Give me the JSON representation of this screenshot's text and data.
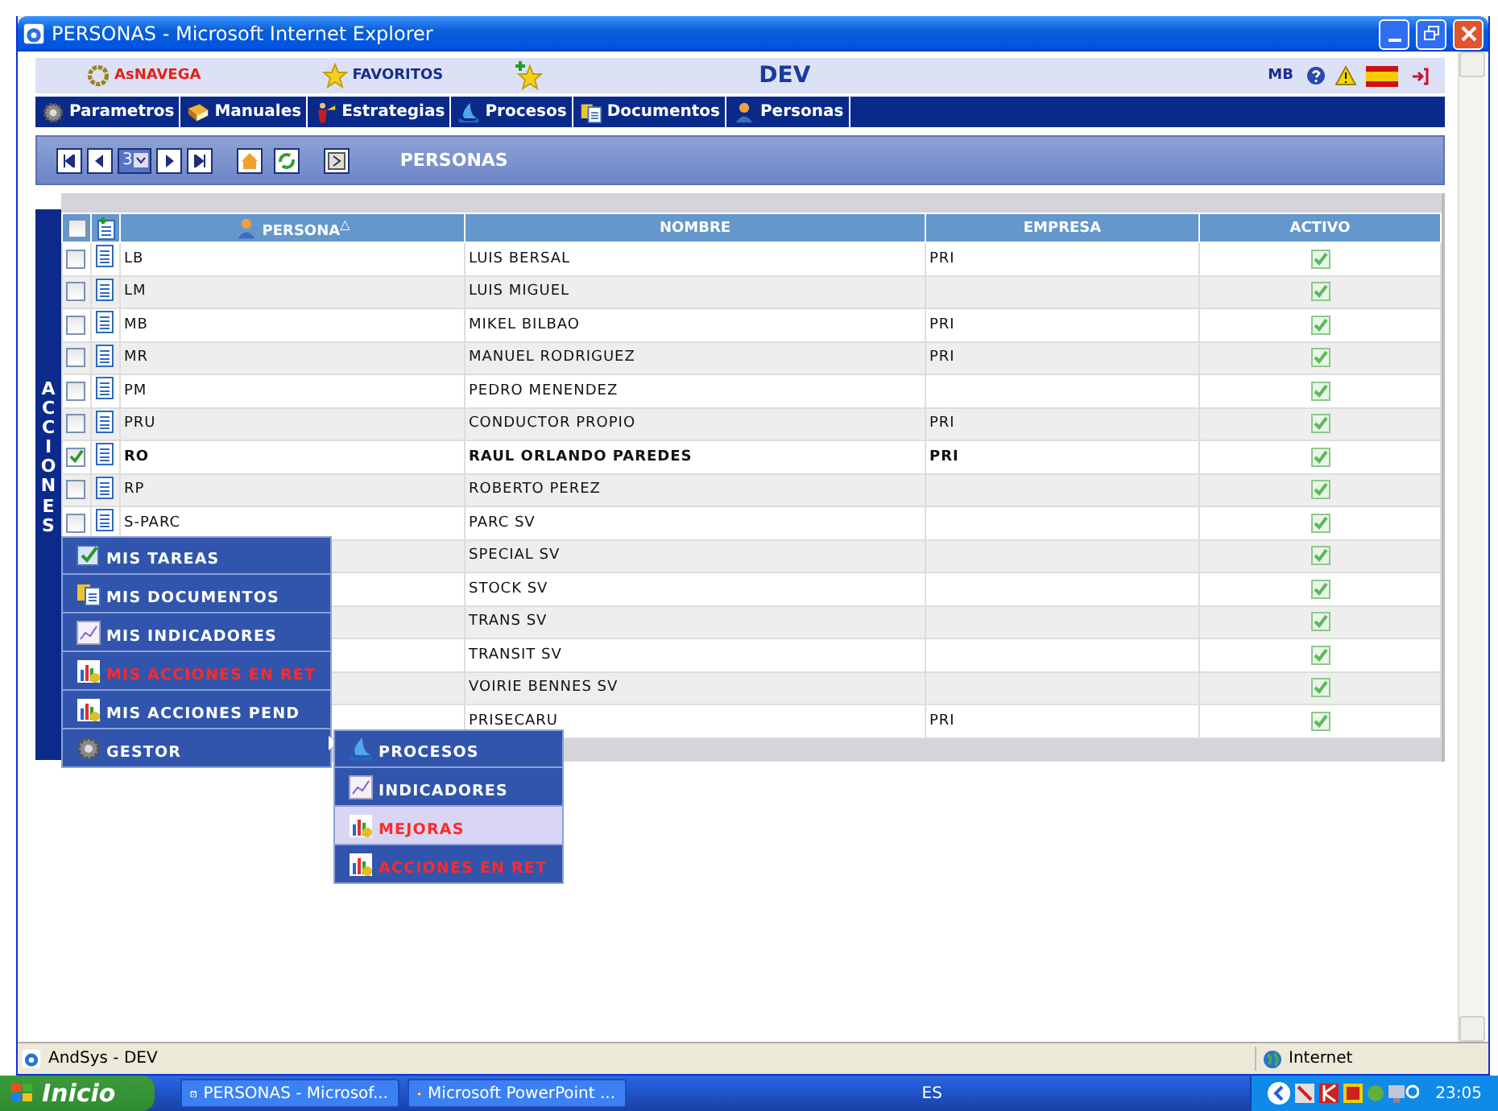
{
  "window": {
    "title": "PERSONAS - Microsoft Internet Explorer"
  },
  "header": {
    "brand": "AsNAVEGA",
    "favorites": "FAVORITOS",
    "environment": "DEV",
    "user": "MB"
  },
  "nav": [
    {
      "label": "Parametros"
    },
    {
      "label": "Manuales"
    },
    {
      "label": "Estrategias"
    },
    {
      "label": "Procesos"
    },
    {
      "label": "Documentos"
    },
    {
      "label": "Personas"
    }
  ],
  "toolbar": {
    "page": "3",
    "title": "PERSONAS"
  },
  "side_tab": {
    "label": "ACCIONES"
  },
  "table": {
    "columns": [
      "PERSONA",
      "NOMBRE",
      "EMPRESA",
      "ACTIVO"
    ],
    "sort_indicator": "△",
    "all_selected": false,
    "rows": [
      {
        "persona": "LB",
        "selected": false,
        "nombre": "LUIS BERSAL",
        "empresa": "PRI",
        "activo": true
      },
      {
        "persona": "LM",
        "selected": false,
        "nombre": "LUIS MIGUEL",
        "activo": true
      },
      {
        "persona": "MB",
        "selected": false,
        "nombre": "MIKEL BILBAO",
        "empresa": "PRI",
        "activo": true
      },
      {
        "persona": "MR",
        "selected": false,
        "nombre": "MANUEL RODRIGUEZ",
        "empresa": "PRI",
        "activo": true
      },
      {
        "persona": "PM",
        "selected": false,
        "nombre": "PEDRO MENENDEZ",
        "activo": true
      },
      {
        "persona": "PRU",
        "selected": false,
        "nombre": "CONDUCTOR PROPIO",
        "empresa": "PRI",
        "activo": true
      },
      {
        "persona": "RO",
        "selected": true,
        "nombre": "RAUL ORLANDO PAREDES",
        "empresa": "PRI",
        "activo": true
      },
      {
        "persona": "RP",
        "selected": false,
        "nombre": "ROBERTO PEREZ",
        "activo": true
      },
      {
        "persona": "S-PARC",
        "selected": false,
        "nombre": "PARC SV",
        "activo": true
      },
      {
        "nombre": "SPECIAL SV",
        "activo": true
      },
      {
        "nombre": "STOCK SV",
        "activo": true
      },
      {
        "nombre": "TRANS SV",
        "activo": true
      },
      {
        "nombre": "TRANSIT SV",
        "activo": true
      },
      {
        "nombre": "VOIRIE BENNES SV",
        "activo": true
      },
      {
        "nombre": "PRISECARU",
        "empresa": "PRI",
        "activo": true
      }
    ]
  },
  "menu": {
    "items": [
      {
        "label": "MIS TAREAS",
        "alert": false,
        "expanded": false
      },
      {
        "label": "MIS DOCUMENTOS",
        "alert": false,
        "expanded": false
      },
      {
        "label": "MIS INDICADORES",
        "alert": false,
        "expanded": false
      },
      {
        "label": "MIS ACCIONES EN RET",
        "alert": true,
        "expanded": false
      },
      {
        "label": "MIS ACCIONES PEND",
        "alert": false,
        "expanded": false
      },
      {
        "label": "GESTOR",
        "alert": false,
        "expanded": true
      }
    ],
    "submenu": [
      {
        "label": "PROCESOS",
        "alert": false,
        "selected": false
      },
      {
        "label": "INDICADORES",
        "alert": false,
        "selected": false
      },
      {
        "label": "MEJORAS",
        "alert": true,
        "selected": true
      },
      {
        "label": "ACCIONES EN RET",
        "alert": true,
        "selected": false
      }
    ]
  },
  "status_bar": {
    "text": "AndSys - DEV",
    "zone": "Internet"
  },
  "taskbar": {
    "start": "Inicio",
    "tasks": [
      {
        "label": "PERSONAS - Microsof..."
      },
      {
        "label": "Microsoft PowerPoint ..."
      }
    ],
    "language": "ES",
    "clock": "23:05"
  }
}
